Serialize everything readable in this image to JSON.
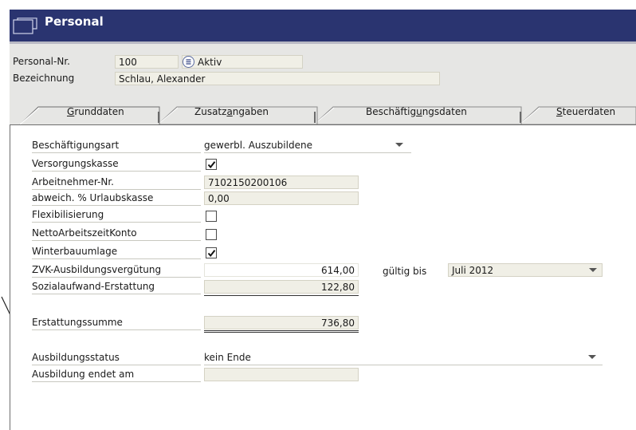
{
  "window": {
    "title": "Personal"
  },
  "header": {
    "personal_nr_label": "Personal-Nr.",
    "personal_nr_value": "100",
    "status_value": "Aktiv",
    "bezeichnung_label": "Bezeichnung",
    "bezeichnung_value": "Schlau, Alexander"
  },
  "tabs": [
    {
      "label": "Grunddaten",
      "underline_char": "G"
    },
    {
      "label": "Zusatzangaben",
      "underline_char": "a"
    },
    {
      "label": "Beschäftigungsdaten",
      "underline_char": "u"
    },
    {
      "label": "Steuerdaten",
      "underline_char": "S"
    }
  ],
  "form": {
    "beschaeftigungsart": {
      "label": "Beschäftigungsart",
      "value": "gewerbl. Auszubildene"
    },
    "versorgungskasse": {
      "label": "Versorgungskasse",
      "checked": true
    },
    "arbeitnehmer_nr": {
      "label": "Arbeitnehmer-Nr.",
      "value": "7102150200106"
    },
    "urlaubskasse": {
      "label": "abweich. % Urlaubskasse",
      "value": "0,00"
    },
    "flexibilisierung": {
      "label": "Flexibilisierung",
      "checked": false
    },
    "nettoarbeitszeitkonto": {
      "label": "NettoArbeitszeitKonto",
      "checked": false
    },
    "winterbauumlage": {
      "label": "Winterbauumlage",
      "checked": true
    },
    "zvk": {
      "label": "ZVK-Ausbildungsvergütung",
      "value": "614,00"
    },
    "gueltig_bis": {
      "label": "gültig bis",
      "value": "Juli 2012"
    },
    "sozialaufwand": {
      "label": "Sozialaufwand-Erstattung",
      "value": "122,80"
    },
    "erstattungssumme": {
      "label": "Erstattungssumme",
      "value": "736,80"
    },
    "ausbildungsstatus": {
      "label": "Ausbildungsstatus",
      "value": "kein Ende"
    },
    "ausbildung_endet": {
      "label": "Ausbildung endet am",
      "value": ""
    }
  }
}
